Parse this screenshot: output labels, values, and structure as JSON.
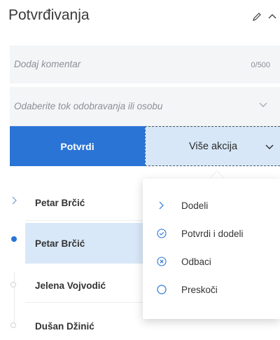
{
  "header": {
    "title": "Potvrđivanja"
  },
  "comment": {
    "placeholder": "Dodaj komentar",
    "counter": "0/500"
  },
  "approver": {
    "placeholder": "Odaberite tok odobravanja ili osobu"
  },
  "actions": {
    "primary_label": "Potvrdi",
    "more_label": "Više akcija"
  },
  "timeline": [
    {
      "name": "Petar Brčić",
      "state": "current-pointer"
    },
    {
      "name": "Petar Brčić",
      "state": "active"
    },
    {
      "name": "Jelena Vojvodić",
      "state": "pending"
    },
    {
      "name": "Dušan Džinić",
      "state": "pending"
    }
  ],
  "menu": {
    "items": [
      {
        "label": "Dodeli",
        "icon": "chevron-right-icon"
      },
      {
        "label": "Potvrdi i dodeli",
        "icon": "check-circle-icon"
      },
      {
        "label": "Odbaci",
        "icon": "x-circle-icon"
      },
      {
        "label": "Preskoči",
        "icon": "circle-icon"
      }
    ]
  },
  "colors": {
    "accent": "#2a74d6",
    "accent_light": "#d7e7f8",
    "menu_icon": "#2a74d6"
  }
}
